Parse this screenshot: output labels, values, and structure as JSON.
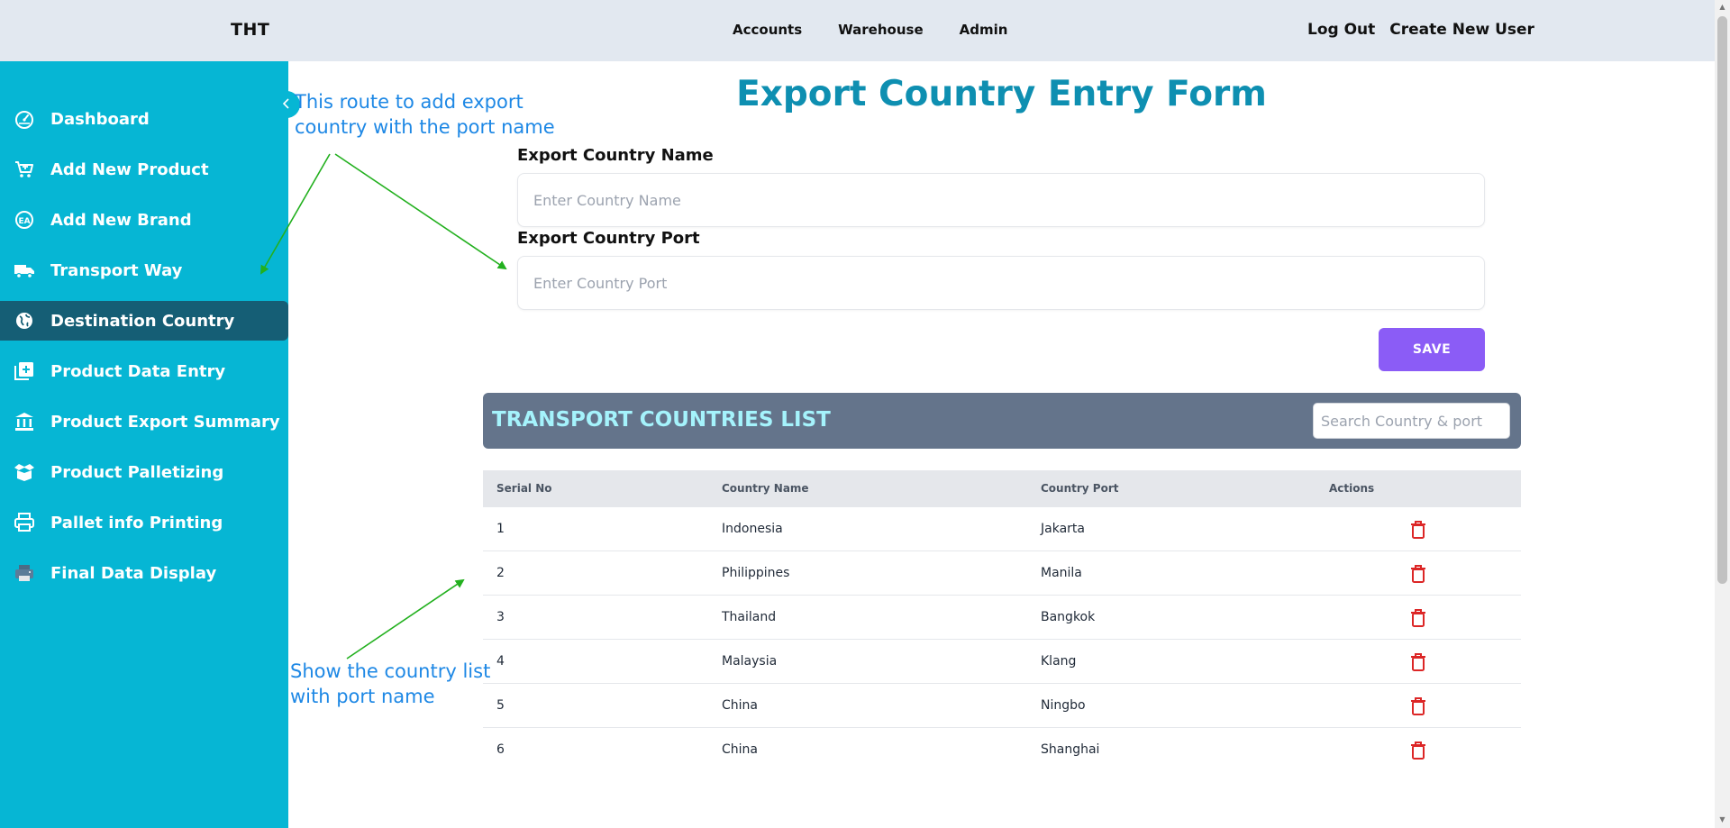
{
  "header": {
    "brand": "THT",
    "nav": [
      "Accounts",
      "Warehouse",
      "Admin"
    ],
    "logout": "Log Out",
    "create_user": "Create New User"
  },
  "sidebar": {
    "items": [
      {
        "label": "Dashboard",
        "icon": "dashboard-icon"
      },
      {
        "label": "Add New Product",
        "icon": "cart-icon"
      },
      {
        "label": "Add New Brand",
        "icon": "brand-badge-icon"
      },
      {
        "label": "Transport Way",
        "icon": "truck-icon"
      },
      {
        "label": "Destination Country",
        "icon": "globe-icon",
        "active": true
      },
      {
        "label": "Product Data Entry",
        "icon": "add-box-icon"
      },
      {
        "label": "Product Export Summary",
        "icon": "bank-icon"
      },
      {
        "label": "Product Palletizing",
        "icon": "box-icon"
      },
      {
        "label": "Pallet info Printing",
        "icon": "printer-icon"
      },
      {
        "label": "Final Data Display",
        "icon": "desktop-printer-icon"
      }
    ]
  },
  "form": {
    "title": "Export Country Entry Form",
    "country_name_label": "Export Country Name",
    "country_name_placeholder": "Enter Country Name",
    "country_port_label": "Export Country Port",
    "country_port_placeholder": "Enter Country Port",
    "save_label": "SAVE"
  },
  "list": {
    "title": "TRANSPORT COUNTRIES LIST",
    "search_placeholder": "Search Country & port",
    "columns": [
      "Serial No",
      "Country Name",
      "Country Port",
      "Actions"
    ],
    "rows": [
      {
        "serial": "1",
        "country": "Indonesia",
        "port": "Jakarta"
      },
      {
        "serial": "2",
        "country": "Philippines",
        "port": "Manila"
      },
      {
        "serial": "3",
        "country": "Thailand",
        "port": "Bangkok"
      },
      {
        "serial": "4",
        "country": "Malaysia",
        "port": "Klang"
      },
      {
        "serial": "5",
        "country": "China",
        "port": "Ningbo"
      },
      {
        "serial": "6",
        "country": "China",
        "port": "Shanghai"
      }
    ]
  },
  "annotations": {
    "top_line1": "This route to add export",
    "top_line2": "country with the port name",
    "bottom_line1": "Show the country list",
    "bottom_line2": "with port name"
  },
  "colors": {
    "sidebar": "#06b6d4",
    "sidebar_active": "#155e75",
    "title": "#0e8fb1",
    "save_button": "#8b5cf6",
    "list_header": "#64748b",
    "delete_icon": "#dc2626",
    "annotation_text": "#1e88e5",
    "annotation_arrow": "#22b01e"
  }
}
